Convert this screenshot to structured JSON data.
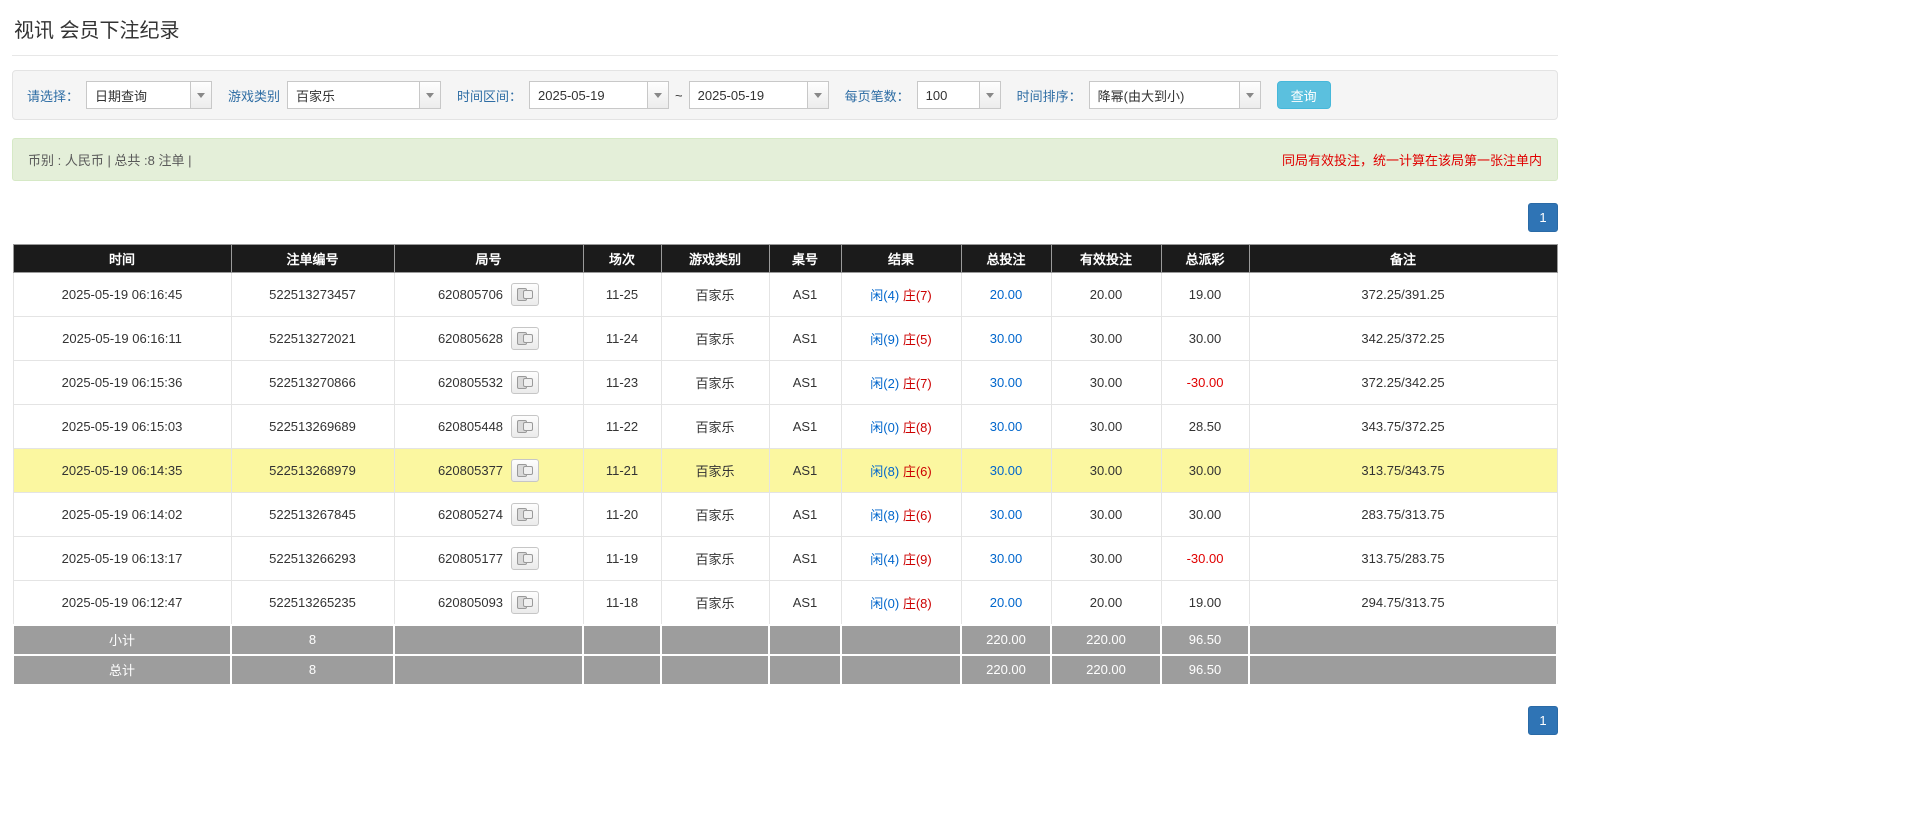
{
  "page": {
    "title": "视讯 会员下注纪录"
  },
  "colors": {
    "accent_blue": "#2f74b5",
    "link_blue": "#0066cc",
    "banker_red": "#cc0000",
    "negative_red": "#e00000",
    "highlight_yellow": "#fbf7a0",
    "header_black": "#1b1b1b",
    "summary_gray": "#9d9d9d",
    "info_green_bg": "#e4efd9",
    "query_button_blue": "#5bc0de"
  },
  "filters": {
    "select_label": "请选择：",
    "select_value": "日期查询",
    "game_label": "游戏类别",
    "game_value": "百家乐",
    "range_label": "时间区间：",
    "date_from": "2025-05-19",
    "range_separator": "~",
    "date_to": "2025-05-19",
    "page_size_label": "每页笔数：",
    "page_size_value": "100",
    "sort_label": "时间排序：",
    "sort_value": "降幂(由大到小)",
    "query_button": "查询"
  },
  "info_bar": {
    "summary": "币别 : 人民币 | 总共 :8 注单 |",
    "notice": "同局有效投注，统一计算在该局第一张注单内"
  },
  "pagination": {
    "current_page": "1"
  },
  "table": {
    "headers": [
      "时间",
      "注单编号",
      "局号",
      "场次",
      "游戏类别",
      "桌号",
      "结果",
      "总投注",
      "有效投注",
      "总派彩",
      "备注"
    ],
    "rows": [
      {
        "time": "2025-05-19 06:16:45",
        "bet_id": "522513273457",
        "round_id": "620805706",
        "session": "11-25",
        "game_type": "百家乐",
        "table_no": "AS1",
        "result_player": "闲(4)",
        "result_banker": "庄(7)",
        "total_bet": "20.00",
        "valid_bet": "20.00",
        "payout": "19.00",
        "remark": "372.25/391.25",
        "highlighted": false
      },
      {
        "time": "2025-05-19 06:16:11",
        "bet_id": "522513272021",
        "round_id": "620805628",
        "session": "11-24",
        "game_type": "百家乐",
        "table_no": "AS1",
        "result_player": "闲(9)",
        "result_banker": "庄(5)",
        "total_bet": "30.00",
        "valid_bet": "30.00",
        "payout": "30.00",
        "remark": "342.25/372.25",
        "highlighted": false
      },
      {
        "time": "2025-05-19 06:15:36",
        "bet_id": "522513270866",
        "round_id": "620805532",
        "session": "11-23",
        "game_type": "百家乐",
        "table_no": "AS1",
        "result_player": "闲(2)",
        "result_banker": "庄(7)",
        "total_bet": "30.00",
        "valid_bet": "30.00",
        "payout": "-30.00",
        "remark": "372.25/342.25",
        "highlighted": false
      },
      {
        "time": "2025-05-19 06:15:03",
        "bet_id": "522513269689",
        "round_id": "620805448",
        "session": "11-22",
        "game_type": "百家乐",
        "table_no": "AS1",
        "result_player": "闲(0)",
        "result_banker": "庄(8)",
        "total_bet": "30.00",
        "valid_bet": "30.00",
        "payout": "28.50",
        "remark": "343.75/372.25",
        "highlighted": false
      },
      {
        "time": "2025-05-19 06:14:35",
        "bet_id": "522513268979",
        "round_id": "620805377",
        "session": "11-21",
        "game_type": "百家乐",
        "table_no": "AS1",
        "result_player": "闲(8)",
        "result_banker": "庄(6)",
        "total_bet": "30.00",
        "valid_bet": "30.00",
        "payout": "30.00",
        "remark": "313.75/343.75",
        "highlighted": true
      },
      {
        "time": "2025-05-19 06:14:02",
        "bet_id": "522513267845",
        "round_id": "620805274",
        "session": "11-20",
        "game_type": "百家乐",
        "table_no": "AS1",
        "result_player": "闲(8)",
        "result_banker": "庄(6)",
        "total_bet": "30.00",
        "valid_bet": "30.00",
        "payout": "30.00",
        "remark": "283.75/313.75",
        "highlighted": false
      },
      {
        "time": "2025-05-19 06:13:17",
        "bet_id": "522513266293",
        "round_id": "620805177",
        "session": "11-19",
        "game_type": "百家乐",
        "table_no": "AS1",
        "result_player": "闲(4)",
        "result_banker": "庄(9)",
        "total_bet": "30.00",
        "valid_bet": "30.00",
        "payout": "-30.00",
        "remark": "313.75/283.75",
        "highlighted": false
      },
      {
        "time": "2025-05-19 06:12:47",
        "bet_id": "522513265235",
        "round_id": "620805093",
        "session": "11-18",
        "game_type": "百家乐",
        "table_no": "AS1",
        "result_player": "闲(0)",
        "result_banker": "庄(8)",
        "total_bet": "20.00",
        "valid_bet": "20.00",
        "payout": "19.00",
        "remark": "294.75/313.75",
        "highlighted": false
      }
    ],
    "summary_rows": [
      {
        "label": "小计",
        "count": "8",
        "total_bet": "220.00",
        "valid_bet": "220.00",
        "payout": "96.50"
      },
      {
        "label": "总计",
        "count": "8",
        "total_bet": "220.00",
        "valid_bet": "220.00",
        "payout": "96.50"
      }
    ]
  }
}
